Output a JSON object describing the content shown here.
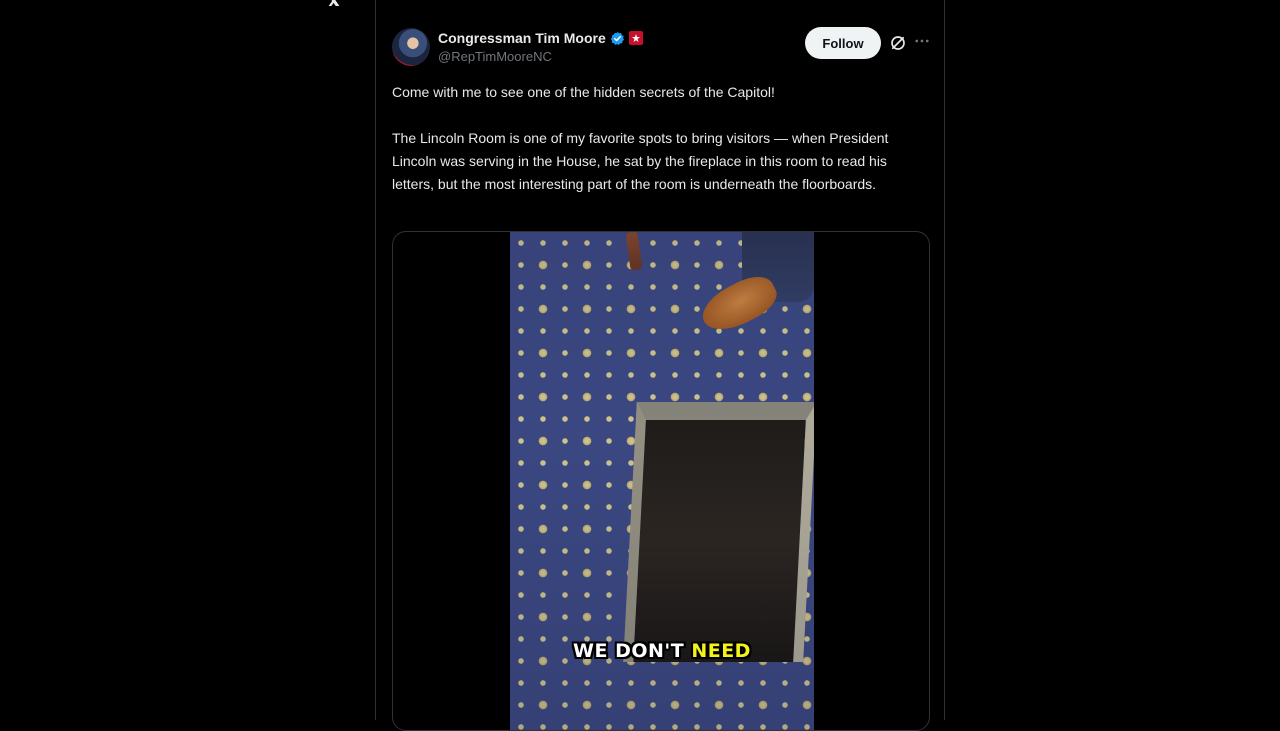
{
  "brand": {
    "logo_icon": "x-logo-icon"
  },
  "post": {
    "author": {
      "display_name": "Congressman Tim Moore",
      "handle": "@RepTimMooreNC",
      "verified_icon": "verified-badge-icon",
      "affiliation_icon": "government-badge-icon",
      "verified_color": "#1d9bf0",
      "affiliation_color": "#c8102e"
    },
    "follow_label": "Follow",
    "grok_icon": "grok-icon",
    "more_icon": "more-options-icon",
    "text_paragraphs": [
      "Come with me to see one of the hidden secrets of the Capitol!",
      "The Lincoln Room is one of my favorite spots to bring visitors — when President Lincoln was serving in the House, he sat by the fireplace in this room to read his letters, but the most interesting part of the room is underneath the floorboards."
    ],
    "video": {
      "caption_white": "WE DON'T ",
      "caption_highlight": "NEED",
      "caption_highlight_color": "#f4f21a"
    }
  }
}
